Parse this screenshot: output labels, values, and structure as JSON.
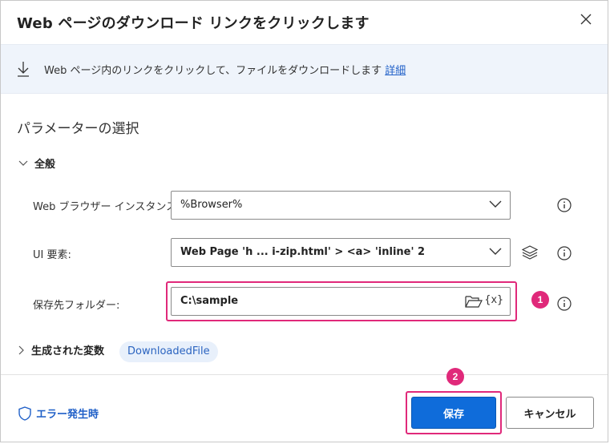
{
  "dialog": {
    "title": "Web ページのダウンロード リンクをクリックします",
    "banner_text": "Web ページ内のリンクをクリックして、ファイルをダウンロードします",
    "banner_link": "詳細",
    "section_title": "パラメーターの選択",
    "group_label": "全般"
  },
  "fields": {
    "browser": {
      "label": "Web ブラウザー インスタンス:",
      "value": "%Browser%"
    },
    "ui_element": {
      "label": "UI 要素:",
      "value": "Web Page 'h ... i-zip.html' > <a> 'inline' 2"
    },
    "folder": {
      "label": "保存先フォルダー:",
      "value": "C:\\sample",
      "var_icon": "{x}"
    }
  },
  "variables": {
    "label": "生成された変数",
    "chip": "DownloadedFile"
  },
  "footer": {
    "on_error": "エラー発生時",
    "save": "保存",
    "cancel": "キャンセル"
  },
  "annotations": {
    "badge1": "1",
    "badge2": "2"
  },
  "colors": {
    "accent": "#0f6cda",
    "highlight": "#e0297a",
    "link": "#2060c8",
    "banner_bg": "#eff4fb"
  }
}
